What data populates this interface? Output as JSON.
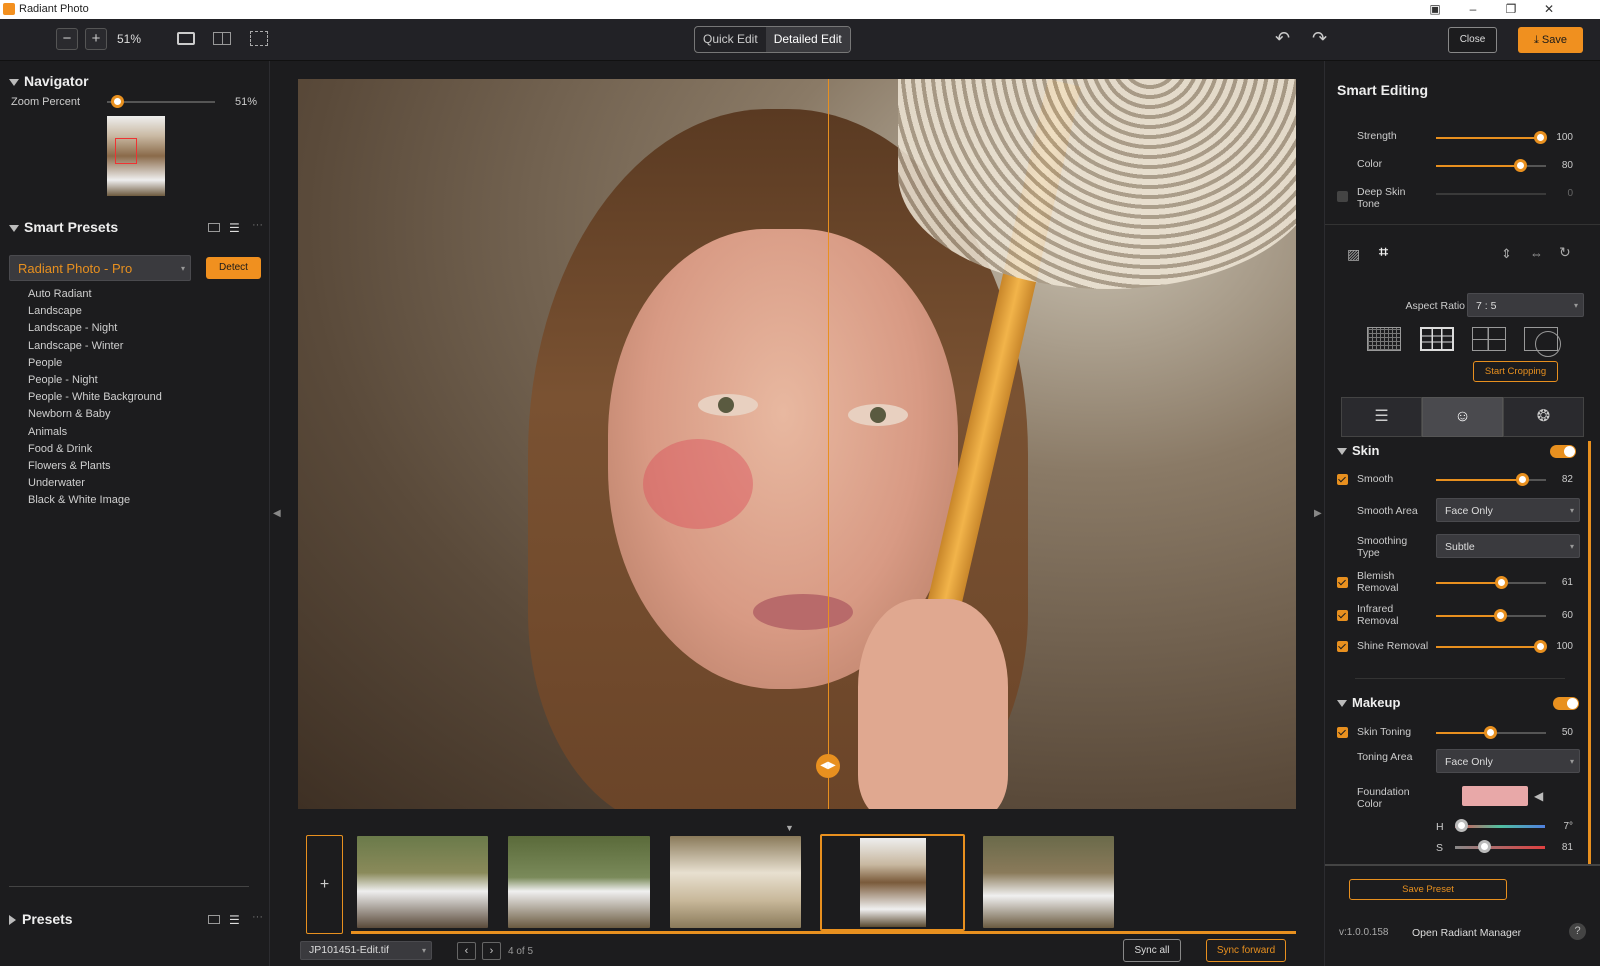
{
  "app": {
    "title": "Radiant Photo"
  },
  "toolbar": {
    "zoom": "51%",
    "mode_quick": "Quick Edit",
    "mode_detailed": "Detailed Edit",
    "close": "Close",
    "save": "Save"
  },
  "navigator": {
    "title": "Navigator",
    "zoom_label": "Zoom Percent",
    "zoom_value": "51%",
    "zoom_fraction": 0.08
  },
  "smart_presets": {
    "title": "Smart Presets",
    "selected": "Radiant Photo - Pro",
    "detect": "Detect",
    "items": [
      "Auto Radiant",
      "Landscape",
      "Landscape - Night",
      "Landscape - Winter",
      "People",
      "People - Night",
      "People - White Background",
      "Newborn & Baby",
      "Animals",
      "Food & Drink",
      "Flowers & Plants",
      "Underwater",
      "Black & White Image"
    ]
  },
  "presets": {
    "title": "Presets"
  },
  "filmstrip": {
    "filename": "JP101451-Edit.tif",
    "page": "4 of 5",
    "sync_all": "Sync all",
    "sync_forward": "Sync forward"
  },
  "smart_editing": {
    "title": "Smart Editing",
    "strength": {
      "label": "Strength",
      "value": "100",
      "fraction": 1.0
    },
    "color": {
      "label": "Color",
      "value": "80",
      "fraction": 0.8
    },
    "deep_skin": {
      "label": "Deep Skin Tone",
      "value": "0",
      "fraction": 0.0
    }
  },
  "crop": {
    "aspect_label": "Aspect Ratio",
    "aspect_value": "7 : 5",
    "start": "Start Cropping"
  },
  "skin": {
    "title": "Skin",
    "smooth": {
      "label": "Smooth",
      "value": "82",
      "fraction": 0.82
    },
    "smooth_area": {
      "label": "Smooth Area",
      "value": "Face Only"
    },
    "smoothing_type": {
      "label": "Smoothing Type",
      "value": "Subtle"
    },
    "blemish": {
      "label": "Blemish Removal",
      "value": "61",
      "fraction": 0.61
    },
    "infrared": {
      "label": "Infrared Removal",
      "value": "60",
      "fraction": 0.6
    },
    "shine": {
      "label": "Shine Removal",
      "value": "100",
      "fraction": 1.0
    }
  },
  "makeup": {
    "title": "Makeup",
    "skin_toning": {
      "label": "Skin Toning",
      "value": "50",
      "fraction": 0.5
    },
    "toning_area": {
      "label": "Toning Area",
      "value": "Face Only"
    },
    "foundation": {
      "label": "Foundation Color",
      "color": "#e8a8a8"
    },
    "h": {
      "label": "H",
      "value": "7°"
    },
    "s": {
      "label": "S",
      "value": "81"
    }
  },
  "footer": {
    "save_preset": "Save Preset",
    "version": "v:1.0.0.158",
    "manager": "Open Radiant Manager",
    "help": "?"
  },
  "colors": {
    "accent": "#e8901f"
  }
}
